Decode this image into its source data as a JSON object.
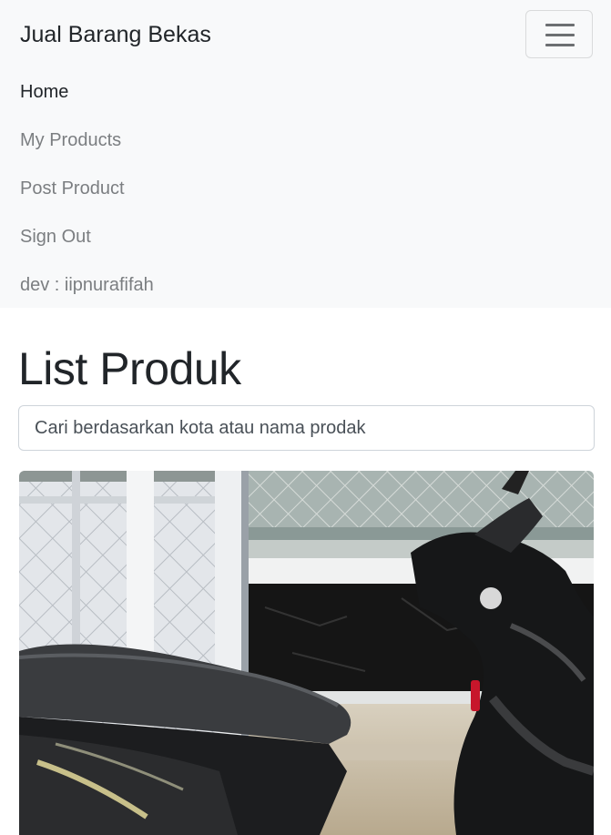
{
  "app": {
    "brand": "Jual Barang Bekas"
  },
  "nav": {
    "items": [
      {
        "label": "Home",
        "active": true
      },
      {
        "label": "My Products",
        "active": false
      },
      {
        "label": "Post Product",
        "active": false
      },
      {
        "label": "Sign Out",
        "active": false
      },
      {
        "label": "dev : iipnurafifah",
        "active": false
      }
    ]
  },
  "main": {
    "title": "List Produk",
    "search": {
      "placeholder": "Cari berdasarkan kota atau nama prodak",
      "value": ""
    }
  },
  "products": [
    {
      "image_subject": "motor-scooter-photo"
    }
  ],
  "colors": {
    "navbar_bg": "#f8f9fa",
    "text_dark": "#212529",
    "text_muted": "#7b7e81",
    "border": "#ced4da"
  }
}
